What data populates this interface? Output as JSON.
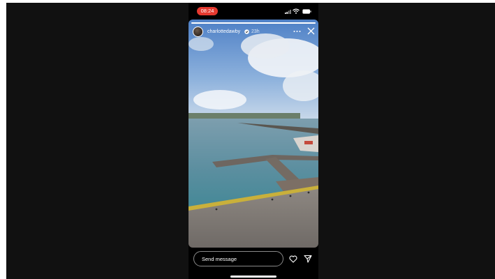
{
  "status_bar": {
    "time": "08:24",
    "time_pill_color": "#e5392f",
    "icons": [
      "signal-icon",
      "wifi-icon",
      "battery-icon"
    ]
  },
  "story": {
    "username": "charlottedawby",
    "verified": true,
    "posted_ago": "23h",
    "progress": 1.0,
    "header_icons": [
      "verified-icon",
      "more-icon",
      "close-icon"
    ]
  },
  "footer": {
    "message_placeholder": "Send message",
    "icons": [
      "heart-icon",
      "share-icon"
    ]
  }
}
